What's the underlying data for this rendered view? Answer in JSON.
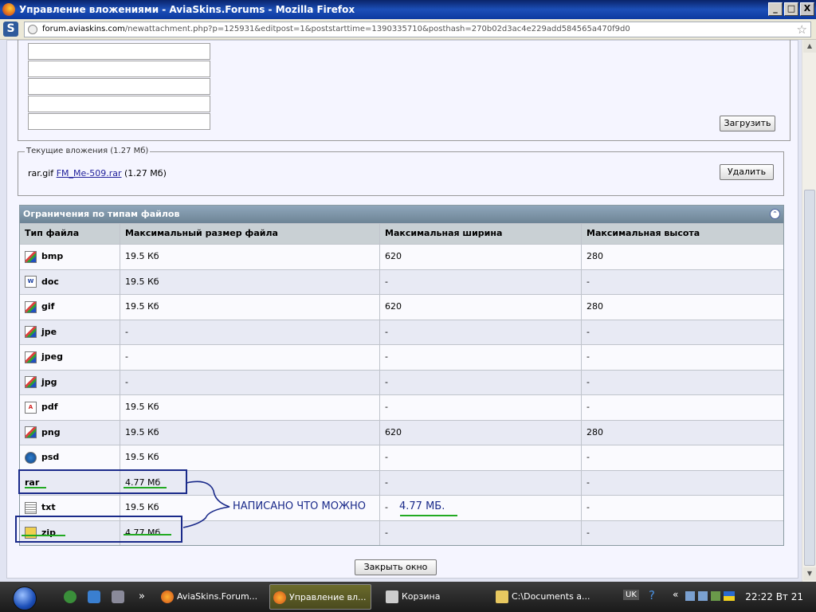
{
  "window": {
    "title": "Управление вложениями - AviaSkins.Forums - Mozilla Firefox",
    "minimize": "_",
    "maximize": "□",
    "close": "X"
  },
  "navbar": {
    "url_host": "forum.aviaskins.com",
    "url_path": "/newattachment.php?p=125931&editpost=1&poststarttime=1390335710&posthash=270b02d3ac4e229add584565a470f9d0",
    "logo": "S"
  },
  "upload": {
    "button_label": "Загрузить"
  },
  "current": {
    "legend": "Текущие вложения (1.27 Мб)",
    "file_icon_name": "rar.gif",
    "file_link": "FM_Me-509.rar",
    "file_size": "(1.27 Мб)",
    "delete_label": "Удалить"
  },
  "limits": {
    "title": "Ограничения по типам файлов",
    "headers": [
      "Тип файла",
      "Максимальный размер файла",
      "Максимальная ширина",
      "Максимальная высота"
    ],
    "rows": [
      {
        "type": "bmp",
        "icon": "image-icon",
        "size": "19.5 Кб",
        "width": "620",
        "height": "280"
      },
      {
        "type": "doc",
        "icon": "word-icon",
        "size": "19.5 Кб",
        "width": "-",
        "height": "-"
      },
      {
        "type": "gif",
        "icon": "image-icon",
        "size": "19.5 Кб",
        "width": "620",
        "height": "280"
      },
      {
        "type": "jpe",
        "icon": "image-icon",
        "size": "-",
        "width": "-",
        "height": "-"
      },
      {
        "type": "jpeg",
        "icon": "image-icon",
        "size": "-",
        "width": "-",
        "height": "-"
      },
      {
        "type": "jpg",
        "icon": "image-icon",
        "size": "-",
        "width": "-",
        "height": "-"
      },
      {
        "type": "pdf",
        "icon": "pdf-icon",
        "size": "19.5 Кб",
        "width": "-",
        "height": "-"
      },
      {
        "type": "png",
        "icon": "image-icon",
        "size": "19.5 Кб",
        "width": "620",
        "height": "280"
      },
      {
        "type": "psd",
        "icon": "photoshop-icon",
        "size": "19.5 Кб",
        "width": "-",
        "height": "-"
      },
      {
        "type": "rar",
        "icon": "",
        "size": "4.77 Мб",
        "width": "-",
        "height": "-"
      },
      {
        "type": "txt",
        "icon": "text-icon",
        "size": "19.5 Кб",
        "width": "-",
        "height": "-"
      },
      {
        "type": "zip",
        "icon": "zip-icon",
        "size": "4.77 Мб",
        "width": "-",
        "height": "-"
      }
    ]
  },
  "annotation": {
    "text": "НАПИСАНО ЧТО МОЖНО",
    "value": "4.77 МБ.",
    "color": "#1a2a8a"
  },
  "close_window_label": "Закрыть окно",
  "taskbar": {
    "tasks": [
      "AviaSkins.Forum...",
      "Управление вл...",
      "Корзина",
      "C:\\Documents a..."
    ],
    "lang": "UK",
    "clock": "22:22 Вт 21"
  }
}
